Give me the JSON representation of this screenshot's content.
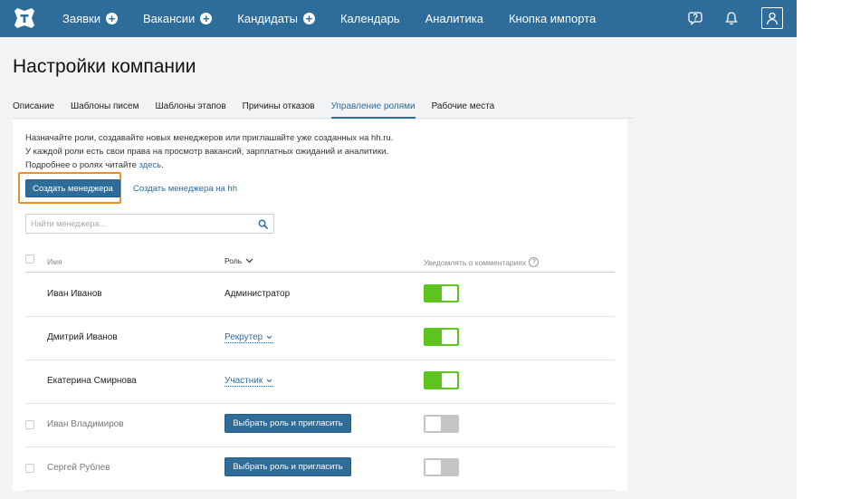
{
  "colors": {
    "header": "#2e6c99",
    "accent": "#2e6c99",
    "toggle_on": "#5fc31f",
    "toggle_off": "#c5c5c5",
    "highlight": "#ee8f2a"
  },
  "header": {
    "nav": [
      {
        "label": "Заявки",
        "has_plus": true
      },
      {
        "label": "Вакансии",
        "has_plus": true
      },
      {
        "label": "Кандидаты",
        "has_plus": true
      },
      {
        "label": "Календарь",
        "has_plus": false
      },
      {
        "label": "Аналитика",
        "has_plus": false
      },
      {
        "label": "Кнопка импорта",
        "has_plus": false
      }
    ],
    "plus_symbol": "+",
    "icons": [
      "logo-icon",
      "help-icon",
      "bell-icon",
      "profile-icon"
    ]
  },
  "page": {
    "title": "Настройки компании"
  },
  "tabs": [
    {
      "label": "Описание",
      "active": false
    },
    {
      "label": "Шаблоны писем",
      "active": false
    },
    {
      "label": "Шаблоны этапов",
      "active": false
    },
    {
      "label": "Причины отказов",
      "active": false
    },
    {
      "label": "Управление ролями",
      "active": true
    },
    {
      "label": "Рабочие места",
      "active": false
    }
  ],
  "intro": {
    "line1": "Назначайте роли, создавайте новых менеджеров или приглашайте уже созданных на hh.ru.",
    "line2": "У каждой роли есть свои права на просмотр вакансий, зарплатных ожиданий и аналитики.",
    "line3_prefix": "Подробнее о ролях читайте ",
    "line3_link": "здесь",
    "line3_suffix": "."
  },
  "actions": {
    "create_manager": "Создать менеджера",
    "create_manager_hh": "Создать менеджера на hh"
  },
  "search": {
    "placeholder": "Найти менеджера...",
    "value": ""
  },
  "table": {
    "headers": {
      "name": "Имя",
      "role": "Роль",
      "notify": "Уведомлять о комментариях",
      "notify_help": "?"
    },
    "rows": [
      {
        "name": "Иван Иванов",
        "role": "Администратор",
        "role_type": "text",
        "notify": true,
        "has_checkbox": false
      },
      {
        "name": "Дмитрий Иванов",
        "role": "Рекрутер",
        "role_type": "dropdown",
        "notify": true,
        "has_checkbox": false
      },
      {
        "name": "Екатерина Смирнова",
        "role": "Участник",
        "role_type": "dropdown",
        "notify": true,
        "has_checkbox": false
      },
      {
        "name": "Иван Владимиров",
        "role": "Выбрать роль и пригласить",
        "role_type": "button",
        "notify": false,
        "has_checkbox": true
      },
      {
        "name": "Сергей Рублев",
        "role": "Выбрать роль и пригласить",
        "role_type": "button",
        "notify": false,
        "has_checkbox": true
      }
    ]
  }
}
